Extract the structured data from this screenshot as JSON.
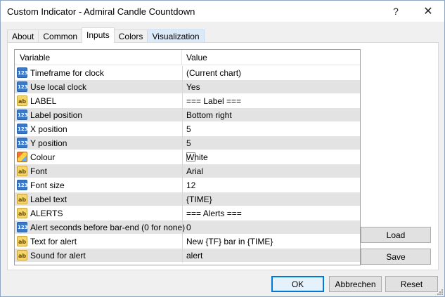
{
  "window": {
    "title": "Custom Indicator - Admiral Candle Countdown",
    "help_glyph": "?",
    "close_glyph": "✕"
  },
  "tabs": [
    {
      "label": "About"
    },
    {
      "label": "Common"
    },
    {
      "label": "Inputs"
    },
    {
      "label": "Colors"
    },
    {
      "label": "Visualization"
    }
  ],
  "active_tab": "Inputs",
  "grid": {
    "header_variable": "Variable",
    "header_value": "Value",
    "rows": [
      {
        "label": "Timeframe for clock",
        "value": "(Current chart)",
        "icon": "numeric-icon"
      },
      {
        "label": "Use local clock",
        "value": "Yes",
        "icon": "numeric-icon"
      },
      {
        "label": "LABEL",
        "value": "=== Label ===",
        "icon": "string-icon"
      },
      {
        "label": "Label position",
        "value": "Bottom right",
        "icon": "numeric-icon"
      },
      {
        "label": "X position",
        "value": "5",
        "icon": "numeric-icon"
      },
      {
        "label": "Y position",
        "value": "5",
        "icon": "numeric-icon"
      },
      {
        "label": "Colour",
        "value": "White",
        "icon": "color-icon",
        "swatch": "#ffffff"
      },
      {
        "label": "Font",
        "value": "Arial",
        "icon": "string-icon"
      },
      {
        "label": "Font size",
        "value": "12",
        "icon": "numeric-icon"
      },
      {
        "label": "Label text",
        "value": "{TIME}",
        "icon": "string-icon"
      },
      {
        "label": "ALERTS",
        "value": "=== Alerts ===",
        "icon": "string-icon"
      },
      {
        "label": "Alert seconds before bar-end (0 for none)",
        "value": "0",
        "icon": "numeric-icon"
      },
      {
        "label": "Text for alert",
        "value": "New {TF} bar in {TIME}",
        "icon": "string-icon"
      },
      {
        "label": "Sound for alert",
        "value": "alert",
        "icon": "string-icon"
      }
    ]
  },
  "icon_glyphs": {
    "numeric": "123",
    "string": "ab"
  },
  "side_buttons": {
    "load": "Load",
    "save": "Save"
  },
  "bottom_buttons": {
    "ok": "OK",
    "cancel": "Abbrechen",
    "reset": "Reset"
  },
  "colors": {
    "focus_accent": "#0078d7",
    "alt_row": "#e3e3e3",
    "active_tab_highlight": "#dce9f7"
  }
}
